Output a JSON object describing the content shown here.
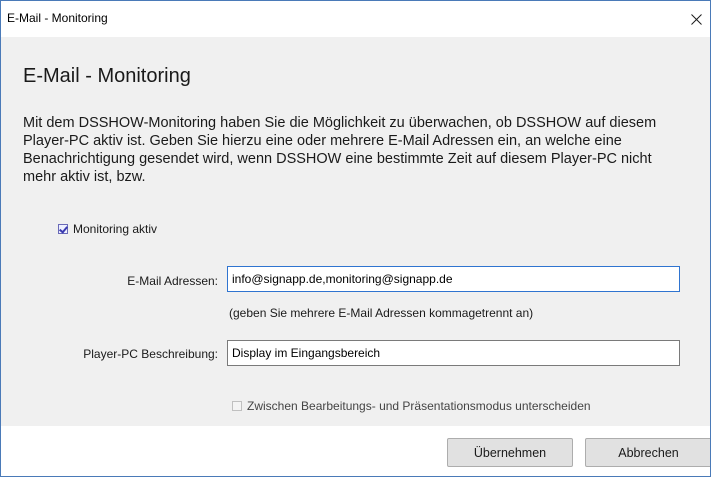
{
  "window": {
    "title": "E-Mail - Monitoring",
    "close_icon": "close-icon"
  },
  "dialog": {
    "heading": "E-Mail - Monitoring",
    "description": "Mit dem DSSHOW-Monitoring haben Sie die Möglichkeit zu überwachen, ob DSSHOW auf diesem Player-PC aktiv ist. Geben Sie hierzu eine oder mehrere E-Mail Adressen ein, an welche eine Benachrichtigung gesendet wird, wenn DSSHOW eine bestimmte Zeit auf diesem Player-PC nicht mehr aktiv ist, bzw.",
    "monitoring_checkbox": {
      "label": "Monitoring aktiv",
      "checked": true
    },
    "email": {
      "label": "E-Mail Adressen:",
      "value": "info@signapp.de,monitoring@signapp.de",
      "hint": "(geben Sie mehrere E-Mail Adressen kommagetrennt an)"
    },
    "player": {
      "label": "Player-PC Beschreibung:",
      "value": "Display im Eingangsbereich"
    },
    "mode_checkbox": {
      "label": "Zwischen Bearbeitungs- und Präsentationsmodus unterscheiden",
      "checked": false
    }
  },
  "buttons": {
    "apply": "Übernehmen",
    "cancel": "Abbrechen"
  },
  "colors": {
    "accent": "#2f74d0",
    "content_background": "#f0f0f0",
    "window_border": "#4a7ab8"
  }
}
